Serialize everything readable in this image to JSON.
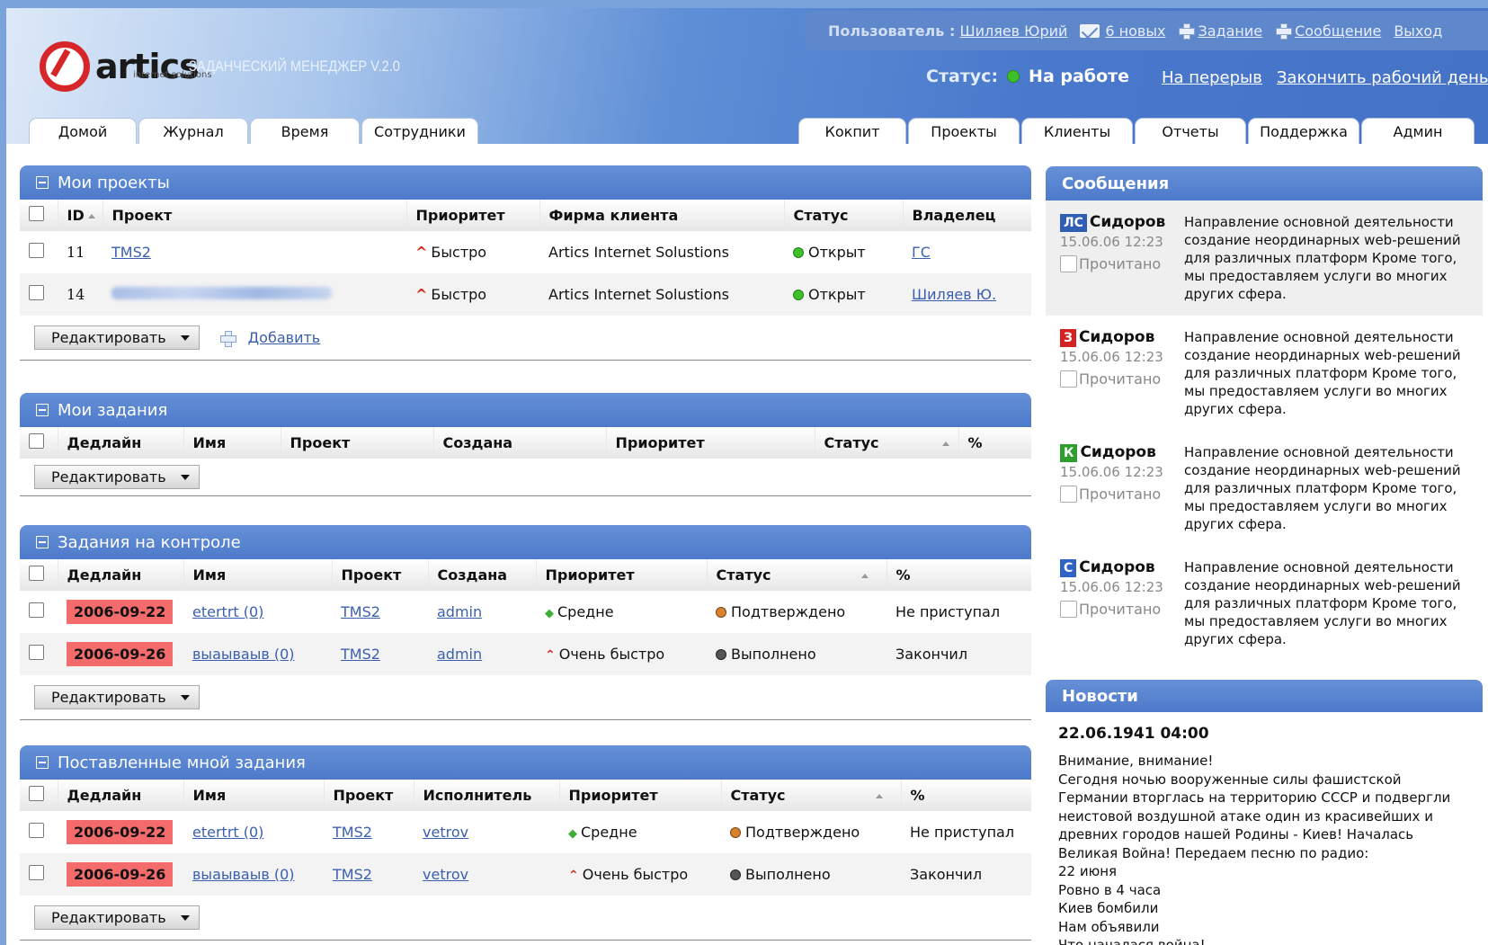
{
  "header": {
    "app_title": "ЗАДАНЧЕСКИЙ МЕНЕДЖЕР V.2.0",
    "logo_name": "artics",
    "logo_sub": "internet solutions",
    "user_label": "Пользователь :",
    "user_name": "Шиляев Юрий",
    "new_messages": "6 новых",
    "add_task": "Задание",
    "add_message": "Сообщение",
    "logout": "Выход",
    "status_label": "Статус:",
    "status_value": "На работе",
    "break_link": "На перерыв",
    "end_day_link": "Закончить рабочий день"
  },
  "tabs_left": [
    "Домой",
    "Журнал",
    "Время",
    "Сотрудники"
  ],
  "tabs_right": [
    "Кокпит",
    "Проекты",
    "Клиенты",
    "Отчеты",
    "Поддержка",
    "Админ"
  ],
  "my_projects": {
    "title": "Мои проекты",
    "columns": [
      "ID",
      "Проект",
      "Приоритет",
      "Фирма клиента",
      "Статус",
      "Владелец"
    ],
    "rows": [
      {
        "id": "11",
        "project": "TMS2",
        "priority": "Быстро",
        "client": "Artics Internet Solustions",
        "status": "Открыт",
        "owner": "ГС"
      },
      {
        "id": "14",
        "project": "",
        "priority": "Быстро",
        "client": "Artics Internet Solustions",
        "status": "Открыт",
        "owner": "Шиляев Ю."
      }
    ],
    "edit_label": "Редактировать",
    "add_label": "Добавить"
  },
  "my_tasks": {
    "title": "Мои задания",
    "columns": [
      "Дедлайн",
      "Имя",
      "Проект",
      "Создана",
      "Приоритет",
      "Статус",
      "%"
    ],
    "edit_label": "Редактировать"
  },
  "control_tasks": {
    "title": "Задания на контроле",
    "columns": [
      "Дедлайн",
      "Имя",
      "Проект",
      "Создана",
      "Приоритет",
      "Статус",
      "%"
    ],
    "rows": [
      {
        "deadline": "2006-09-22",
        "name": "etertrt (0)",
        "project": "TMS2",
        "created": "admin",
        "priority": "Средне",
        "status": "Подтверждено",
        "percent": "Не приступал"
      },
      {
        "deadline": "2006-09-26",
        "name": "выаываыв (0)",
        "project": "TMS2",
        "created": "admin",
        "priority": "Очень быстро",
        "status": "Выполнено",
        "percent": "Закончил"
      }
    ],
    "edit_label": "Редактировать"
  },
  "assigned_tasks": {
    "title": "Поставленные мной задания",
    "columns": [
      "Дедлайн",
      "Имя",
      "Проект",
      "Исполнитель",
      "Приоритет",
      "Статус",
      "%"
    ],
    "rows": [
      {
        "deadline": "2006-09-22",
        "name": "etertrt (0)",
        "project": "TMS2",
        "assignee": "vetrov",
        "priority": "Средне",
        "status": "Подтверждено",
        "percent": "Не приступал"
      },
      {
        "deadline": "2006-09-26",
        "name": "выаываыв (0)",
        "project": "TMS2",
        "assignee": "vetrov",
        "priority": "Очень быстро",
        "status": "Выполнено",
        "percent": "Закончил"
      }
    ],
    "edit_label": "Редактировать"
  },
  "messages": {
    "title": "Сообщения",
    "read_label": "Прочитано",
    "items": [
      {
        "badge": "ЛС",
        "badge_color": "#2f5fb3",
        "from": "Сидоров",
        "date": "15.06.06 12:23",
        "text": "Направление основной деятельности создание неординарных web-решений для различных платформ Кроме того, мы предоставляем услуги во многих других сфера."
      },
      {
        "badge": "З",
        "badge_color": "#d42222",
        "from": "Сидоров",
        "date": "15.06.06 12:23",
        "text": "Направление основной деятельности создание неординарных web-решений для различных платформ Кроме того, мы предоставляем услуги во многих других сфера."
      },
      {
        "badge": "К",
        "badge_color": "#2f9e2f",
        "from": "Сидоров",
        "date": "15.06.06 12:23",
        "text": "Направление основной деятельности создание неординарных web-решений для различных платформ Кроме того, мы предоставляем услуги во многих других сфера."
      },
      {
        "badge": "С",
        "badge_color": "#2f63c4",
        "from": "Сидоров",
        "date": "15.06.06 12:23",
        "text": "Направление основной деятельности создание неординарных web-решений для различных платформ Кроме того, мы предоставляем услуги во многих других сфера."
      }
    ]
  },
  "news": {
    "title": "Новости",
    "date": "22.06.1941 04:00",
    "lines": [
      "Внимание, внимание!",
      "Сегодня ночью вооруженные силы фашистской",
      "Германии вторглась на территорию СССР и подвергли",
      "неистовой воздушной атаке один из красивейших и",
      "древних городов нашей Родины - Киев! Началась",
      "Великая Война! Передаем песню по радио:",
      "22 июня",
      "Ровно в 4 часа",
      "Киев бомбили",
      "Нам объявили",
      "Что началася война!"
    ]
  },
  "colors": {
    "header_blue": "#4a78cc",
    "deadline_red": "#f36b6b",
    "status_green": "#3fbf2a",
    "status_orange": "#d9822b",
    "status_gray": "#666666",
    "link_blue": "#3b5fb0"
  }
}
